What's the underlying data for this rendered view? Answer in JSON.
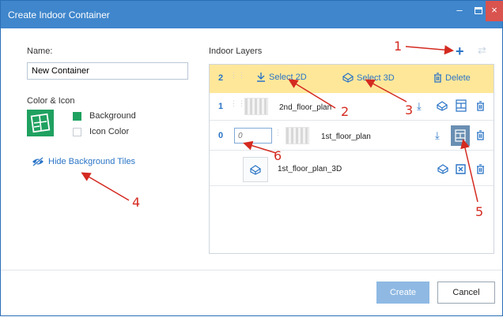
{
  "window": {
    "title": "Create Indoor Container",
    "min": "–",
    "close": "×"
  },
  "left": {
    "name_label": "Name:",
    "name_value": "New Container",
    "color_label": "Color & Icon",
    "background_label": "Background",
    "background_color": "#1fa160",
    "icon_color_label": "Icon Color",
    "hide_link": "Hide Background Tiles"
  },
  "layers": {
    "title": "Indoor Layers",
    "active_row": {
      "index": "2",
      "select2d": "Select 2D",
      "select3d": "Select 3D",
      "delete": "Delete"
    },
    "rows": [
      {
        "index": "1",
        "name": "2nd_floor_plan"
      },
      {
        "index": "0",
        "name": "1st_floor_plan",
        "input_placeholder": "0"
      },
      {
        "name": "1st_floor_plan_3D"
      }
    ]
  },
  "footer": {
    "create": "Create",
    "cancel": "Cancel"
  },
  "annotations": [
    "1",
    "2",
    "3",
    "4",
    "5",
    "6"
  ],
  "colors": {
    "accent": "#2a74c6",
    "titlebar": "#3f86cc",
    "highlight": "#ffe79a",
    "annotation": "#d42a20"
  }
}
